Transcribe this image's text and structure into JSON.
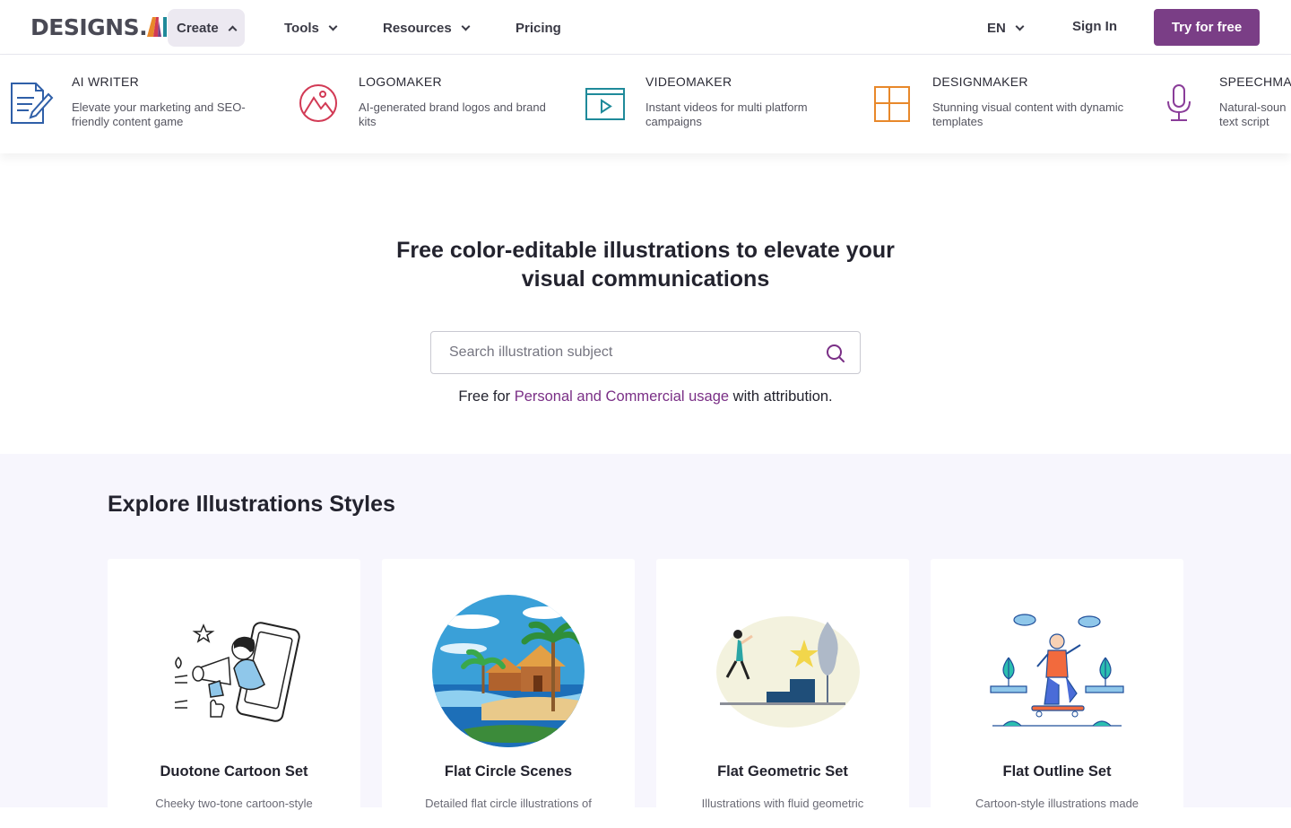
{
  "brand": {
    "logo_text": "DESIGNS.",
    "logo_ai": "AI"
  },
  "nav": {
    "items": [
      {
        "label": "Create",
        "active": true,
        "expanded": true
      },
      {
        "label": "Tools",
        "active": false
      },
      {
        "label": "Resources",
        "active": false
      },
      {
        "label": "Pricing",
        "active": false
      }
    ],
    "language": "EN",
    "sign_in": "Sign In",
    "cta": "Try for free"
  },
  "mega_menu": {
    "products": [
      {
        "name": "AI WRITER",
        "description": "Elevate your marketing and SEO-friendly content game",
        "icon": "document-pen-icon",
        "color": "#2f5fa8"
      },
      {
        "name": "LOGOMAKER",
        "description": "AI-generated brand logos and brand kits",
        "icon": "mountain-circle-icon",
        "color": "#d23a55"
      },
      {
        "name": "VIDEOMAKER",
        "description": "Instant videos for multi platform campaigns",
        "icon": "video-play-icon",
        "color": "#1f8a9a"
      },
      {
        "name": "DESIGNMAKER",
        "description": "Stunning visual content with dynamic templates",
        "icon": "layout-grid-icon",
        "color": "#e8882a"
      },
      {
        "name": "SPEECHMA",
        "description": "Natural-soun text script",
        "icon": "microphone-icon",
        "color": "#8a3d99"
      }
    ]
  },
  "hero": {
    "title_line1": "Free color-editable illustrations to elevate your",
    "title_line2": "visual communications",
    "search_placeholder": "Search illustration subject",
    "usage_prefix": "Free for ",
    "usage_link": "Personal and Commercial usage",
    "usage_suffix": " with attribution."
  },
  "explore": {
    "heading": "Explore Illustrations Styles",
    "cards": [
      {
        "title": "Duotone Cartoon Set",
        "description": "Cheeky two-tone cartoon-style"
      },
      {
        "title": "Flat Circle Scenes",
        "description": "Detailed flat circle illustrations of"
      },
      {
        "title": "Flat Geometric Set",
        "description": "Illustrations with fluid geometric"
      },
      {
        "title": "Flat Outline Set",
        "description": "Cartoon-style illustrations made"
      }
    ]
  },
  "colors": {
    "accent": "#7a3e86",
    "link": "#7a2f86",
    "section_bg": "#f7f6fd"
  }
}
